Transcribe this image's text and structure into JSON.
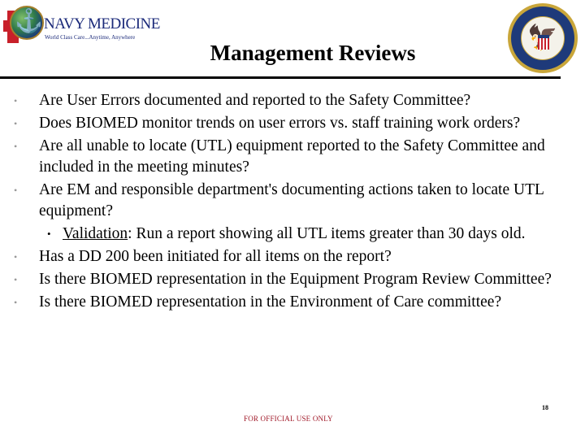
{
  "header": {
    "logo": {
      "brand": "NAVY MEDICINE",
      "tagline": "World Class Care...Anytime, Anywhere",
      "icon": "anchor-icon",
      "accent_red": "#c8202a",
      "accent_blue": "#1b2a7a"
    },
    "seal": {
      "name": "Department of the Navy Bureau of Medicine and Surgery seal",
      "icon": "eagle-icon"
    }
  },
  "slide": {
    "title": "Management Reviews",
    "bullets": [
      {
        "text": "Are User Errors documented and reported to the Safety Committee?"
      },
      {
        "text": "Does BIOMED monitor trends on user errors vs. staff training work orders?"
      },
      {
        "text": "Are all unable to locate (UTL) equipment reported to the Safety Committee and included in the meeting minutes?"
      },
      {
        "text": "Are EM and responsible department's documenting actions taken to locate UTL equipment?"
      },
      {
        "text": "Has a DD 200 been initiated for all items on the report?"
      },
      {
        "text": "Is there BIOMED representation in the Equipment Program Review Committee?"
      },
      {
        "text": "Is there BIOMED representation in the Environment of Care committee?"
      }
    ],
    "sub_bullet": {
      "label": "Validation",
      "text": ": Run a report showing all UTL items greater than 30 days old."
    }
  },
  "footer": {
    "page_number": "18",
    "classification": "FOR OFFICIAL USE ONLY",
    "classification_color": "#a01828"
  }
}
